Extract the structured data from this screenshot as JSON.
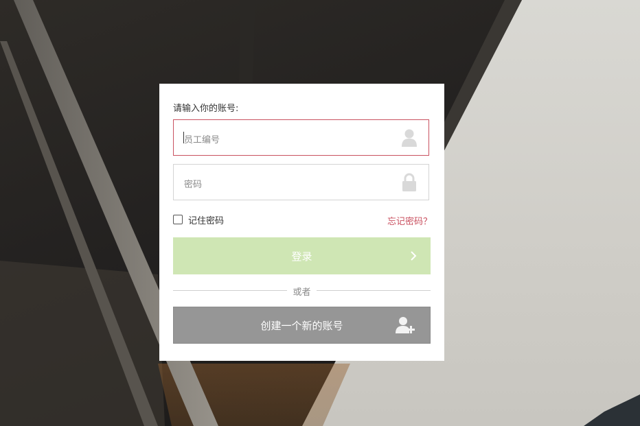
{
  "login": {
    "prompt": "请输入你的账号:",
    "username_placeholder": "员工编号",
    "password_placeholder": "密码",
    "remember_label": "记住密码",
    "forgot_link": "忘记密码？",
    "login_button": "登录",
    "divider_text": "或者",
    "create_account_button": "创建一个新的账号"
  },
  "icons": {
    "username": "user-icon",
    "password": "lock-icon",
    "login": "chevron-right-icon",
    "create": "add-user-icon"
  },
  "colors": {
    "accent": "#c9505f",
    "login_button_bg": "#cfe6b4",
    "create_button_bg": "#969696",
    "icon_gray": "#d9d9d9"
  }
}
